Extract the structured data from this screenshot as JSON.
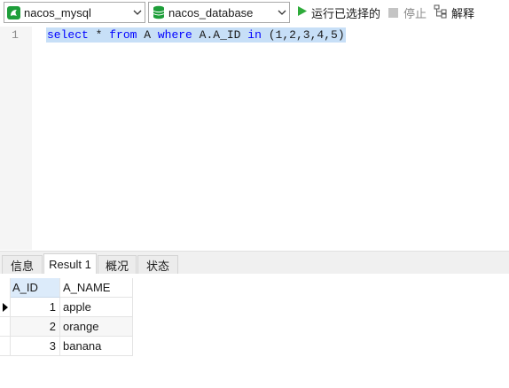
{
  "toolbar": {
    "connection": "nacos_mysql",
    "database": "nacos_database",
    "run_selected_label": "运行已选择的",
    "stop_label": "停止",
    "explain_label": "解释"
  },
  "editor": {
    "line_number": "1",
    "tokens": [
      {
        "text": "select",
        "type": "keyword"
      },
      {
        "text": " * ",
        "type": "op"
      },
      {
        "text": "from",
        "type": "keyword"
      },
      {
        "text": " A ",
        "type": "ident"
      },
      {
        "text": "where",
        "type": "keyword"
      },
      {
        "text": " A.A_ID ",
        "type": "ident"
      },
      {
        "text": "in",
        "type": "keyword"
      },
      {
        "text": " (",
        "type": "op"
      },
      {
        "text": "1",
        "type": "num"
      },
      {
        "text": ",",
        "type": "op"
      },
      {
        "text": "2",
        "type": "num"
      },
      {
        "text": ",",
        "type": "op"
      },
      {
        "text": "3",
        "type": "num"
      },
      {
        "text": ",",
        "type": "op"
      },
      {
        "text": "4",
        "type": "num"
      },
      {
        "text": ",",
        "type": "op"
      },
      {
        "text": "5",
        "type": "num"
      },
      {
        "text": ")",
        "type": "op"
      }
    ],
    "keyword_color": "#0000ff",
    "selection_color": "#c7dff7"
  },
  "tabs": [
    {
      "label": "信息"
    },
    {
      "label": "Result 1",
      "active": true
    },
    {
      "label": "概况"
    },
    {
      "label": "状态"
    }
  ],
  "result": {
    "columns": [
      "A_ID",
      "A_NAME"
    ],
    "rows": [
      {
        "id": "1",
        "name": "apple",
        "current": true
      },
      {
        "id": "2",
        "name": "orange"
      },
      {
        "id": "3",
        "name": "banana"
      }
    ]
  },
  "colors": {
    "run_icon": "#2eab3a",
    "db_icon": "#1e9e3a",
    "header_selected": "#dcebfa"
  }
}
